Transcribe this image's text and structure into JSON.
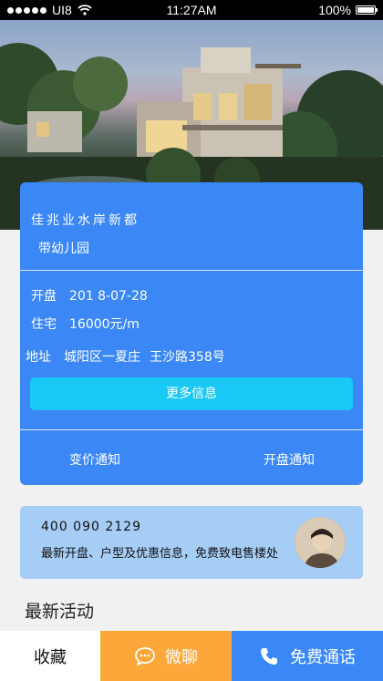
{
  "status_bar": {
    "carrier": "UI8",
    "time": "11:27AM",
    "battery": "100%",
    "icons": [
      "signal-dots-icon",
      "wifi-icon",
      "battery-icon"
    ]
  },
  "hero": {
    "icon": "villa-photo"
  },
  "property": {
    "name": "佳兆业水岸新都",
    "tag": "带幼儿园",
    "opening_label": "开盘",
    "opening_date": "201 8-07-28",
    "residential_label": "住宅",
    "residential_price": "16000元/m",
    "address_label": "地址",
    "address_district": "城阳区一夏庄",
    "address_road": "王沙路358号",
    "more_button": "更多信息",
    "price_notify": "变价通知",
    "opening_notify": "开盘通知"
  },
  "contact": {
    "phone": "400  090  2129",
    "description": "最新开盘、户型及优惠信息，免费致电售楼处"
  },
  "section": {
    "title": "最新活动"
  },
  "bottom_bar": {
    "favorite": "收藏",
    "chat": "微聊",
    "call": "免费通话",
    "colors": {
      "chat": "#fba73a",
      "call": "#3a88f5"
    }
  },
  "colors": {
    "card": "#3a87f5",
    "more_button": "#19c8f5",
    "contact_card": "#a6cdf6"
  }
}
